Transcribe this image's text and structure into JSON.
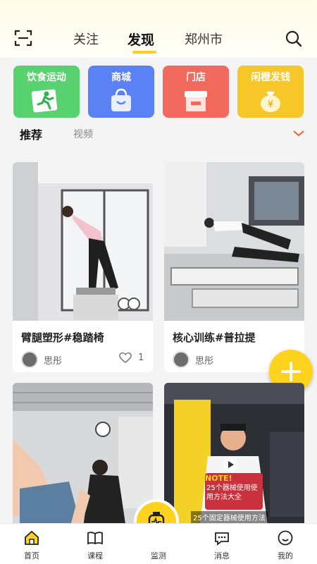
{
  "header": {
    "tabs": [
      {
        "label": "关注",
        "active": false
      },
      {
        "label": "发现",
        "active": true
      },
      {
        "label": "郑州市",
        "active": false
      }
    ]
  },
  "categories": [
    {
      "label": "饮食运动",
      "color": "#57d26e",
      "icon": "running-person-icon"
    },
    {
      "label": "商城",
      "color": "#5b82f5",
      "icon": "shopping-bag-icon"
    },
    {
      "label": "门店",
      "color": "#f2695e",
      "icon": "storefront-icon"
    },
    {
      "label": "闲橙发钱",
      "color": "#f7c72a",
      "icon": "money-bag-icon"
    }
  ],
  "subtabs": {
    "active": "推荐",
    "other": "视频"
  },
  "cards": [
    {
      "title": "臂腿塑形#稳踏椅",
      "author": "思彤",
      "likes": "1"
    },
    {
      "title": "核心训练#普拉提",
      "author": "思彤",
      "likes": ""
    },
    {
      "title": "",
      "author": "",
      "likes": ""
    },
    {
      "title": "",
      "author": "",
      "likes": "",
      "overlay_label": "NOTE!",
      "overlay_text": "25个器械使用使用方法大全",
      "caption": "25个固定器械使用方法"
    }
  ],
  "nav": [
    {
      "label": "首页",
      "icon": "home-icon",
      "active": true
    },
    {
      "label": "课程",
      "icon": "book-icon",
      "active": false
    },
    {
      "label": "监测",
      "icon": "watch-icon",
      "active": false
    },
    {
      "label": "消息",
      "icon": "chat-icon",
      "active": false
    },
    {
      "label": "我的",
      "icon": "smiley-icon",
      "active": false
    }
  ],
  "colors": {
    "accent": "#ffd21e",
    "underline": "#ffcf1b",
    "chevron": "#f0642c"
  }
}
